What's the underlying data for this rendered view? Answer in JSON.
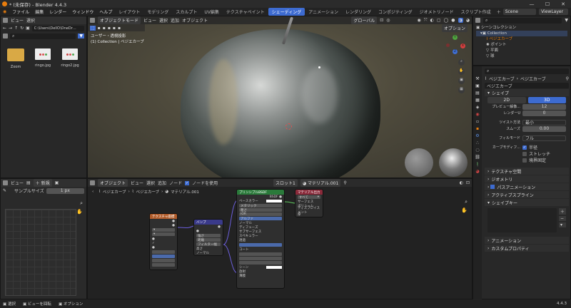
{
  "window": {
    "title": "* (未保存) - Blender 4.4.3"
  },
  "menu": [
    "ファイル",
    "編集",
    "レンダー",
    "ウィンドウ",
    "ヘルプ"
  ],
  "workspaces": [
    "レイアウト",
    "モデリング",
    "スカルプト",
    "UV編集",
    "テクスチャペイント",
    "シェーディング",
    "アニメーション",
    "レンダリング",
    "コンポジティング",
    "ジオメトリノード",
    "スクリプト作成"
  ],
  "active_workspace": "シェーディング",
  "scene": {
    "label": "Scene",
    "view_layer": "ViewLayer"
  },
  "file_browser": {
    "menu_view": "ビュー",
    "menu_select": "選択",
    "path": "C:\\Users\\DellO\\OneDr…",
    "items": [
      {
        "name": "Zoom"
      },
      {
        "name": "ringo.jpg"
      },
      {
        "name": "ringo2.jpg"
      }
    ]
  },
  "viewport": {
    "mode": "オブジェクトモード",
    "menus": [
      "ビュー",
      "選択",
      "追加",
      "オブジェクト"
    ],
    "transform": "グローバル",
    "info1": "ユーザー・透視投影",
    "info2": "(1) Collection | ベジエカーブ",
    "options": "オプション"
  },
  "outliner": {
    "title": "シーンコレクション",
    "collection": "Collection",
    "items": [
      "ベジエカーブ",
      "ポイント",
      "平面",
      "球"
    ]
  },
  "props": {
    "breadcrumb_a": "ベジエカーブ",
    "breadcrumb_b": "ベジエカーブ",
    "name": "ベジエカーブ",
    "shape_section": "シェイプ",
    "toggle_2d": "2D",
    "toggle_3d": "3D",
    "preview_label": "プレビュー解像...",
    "preview_val": "12",
    "render_label": "レンダーU",
    "render_val": "0",
    "twist_label": "ツイスト方法",
    "twist_val": "最小",
    "smooth_label": "スムーズ",
    "smooth_val": "0.00",
    "fill_label": "フィルモード",
    "fill_val": "フル",
    "deform_label": "カーブモディフ...",
    "radius": "半径",
    "stretch": "ストレッチ",
    "clamp": "境界固定",
    "sections": [
      "テクスチャ空間",
      "ジオメトリ",
      "パスアニメーション",
      "アクティブスプライン",
      "シェイプキー",
      "アニメーション",
      "カスタムプロパティ"
    ]
  },
  "image_editor": {
    "menu_view": "ビュー",
    "new": "新規",
    "sample_label": "サンプルサイズ",
    "sample_val": "1 px"
  },
  "node_editor": {
    "object": "オブジェクト",
    "menus": [
      "ビュー",
      "選択",
      "追加",
      "ノード"
    ],
    "use_nodes": "ノードを使用",
    "slot": "スロット1",
    "material": "マテリアル.001",
    "breadcrumb": [
      "ベジエカーブ",
      "ベジエカーブ",
      "マテリアル.001"
    ]
  },
  "nodes": {
    "n1": {
      "title": "テクスチャ座標"
    },
    "n2": {
      "title": "バンプ",
      "rows": [
        "強さ",
        "距離",
        "フィルター幅",
        "高さ",
        "ノーマル"
      ]
    },
    "n3": {
      "title": "プリンシプルBSDF",
      "rows": [
        "ベースカラー",
        "メタリック",
        "粗さ",
        "IOR",
        "アルファ",
        "ノーマル",
        "ディフューズ",
        "サブサーフェス",
        "スペキュラー",
        "透過",
        "コート",
        "シーン",
        "放射",
        "薄膜"
      ]
    },
    "n4": {
      "title": "マテリアル出力",
      "rows": [
        "すべて",
        "サーフェス",
        "ボリューム",
        "ディスプレイスメント",
        "厚"
      ]
    }
  },
  "status": {
    "select": "選択",
    "rotate": "ビューを回転",
    "options": "オプション",
    "version": "4.4.3"
  }
}
